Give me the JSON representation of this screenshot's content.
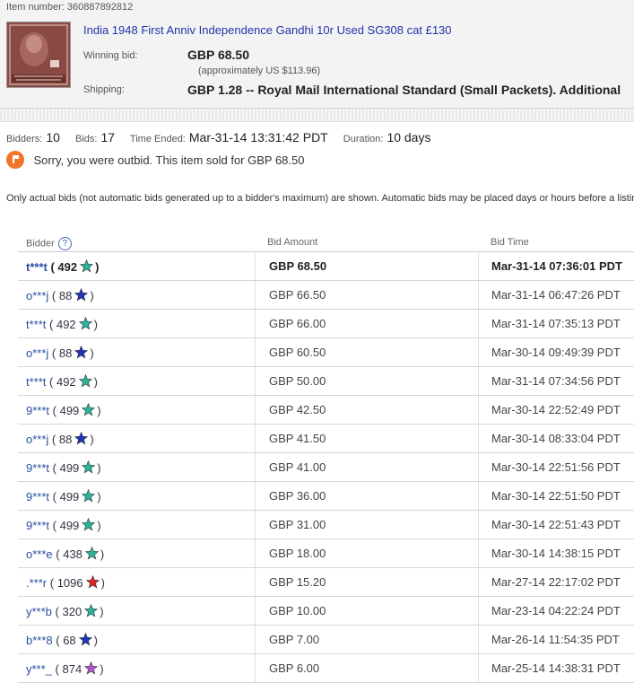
{
  "item": {
    "number_text": "Item number: 360887892812",
    "title": "India 1948 First Anniv Independence Gandhi 10r Used SG308 cat £130",
    "winning_bid_label": "Winning bid:",
    "winning_bid": "GBP 68.50",
    "winning_bid_approx": "(approximately US $113.96)",
    "shipping_label": "Shipping:",
    "shipping": "GBP 1.28 -- Royal Mail International Standard (Small Packets).  Additional"
  },
  "stats": {
    "bidders_label": "Bidders:",
    "bidders": "10",
    "bids_label": "Bids:",
    "bids": "17",
    "time_ended_label": "Time Ended:",
    "time_ended": "Mar-31-14 13:31:42 PDT",
    "duration_label": "Duration:",
    "duration": "10 days"
  },
  "outbid_message": "Sorry, you were outbid. This item sold for GBP 68.50",
  "note": "Only actual bids (not automatic bids generated up to a bidder's maximum) are shown. Automatic bids may be placed days or hours before a listing",
  "table": {
    "headers": {
      "bidder": "Bidder",
      "help": "?",
      "amount": "Bid Amount",
      "time": "Bid Time"
    },
    "rows": [
      {
        "name": "t***t",
        "score": "492",
        "star": "teal",
        "amount": "GBP 68.50",
        "time": "Mar-31-14 07:36:01 PDT"
      },
      {
        "name": "o***j",
        "score": "88",
        "star": "blue",
        "amount": "GBP 66.50",
        "time": "Mar-31-14 06:47:26 PDT"
      },
      {
        "name": "t***t",
        "score": "492",
        "star": "teal",
        "amount": "GBP 66.00",
        "time": "Mar-31-14 07:35:13 PDT"
      },
      {
        "name": "o***j",
        "score": "88",
        "star": "blue",
        "amount": "GBP 60.50",
        "time": "Mar-30-14 09:49:39 PDT"
      },
      {
        "name": "t***t",
        "score": "492",
        "star": "teal",
        "amount": "GBP 50.00",
        "time": "Mar-31-14 07:34:56 PDT"
      },
      {
        "name": "9***t",
        "score": "499",
        "star": "teal",
        "amount": "GBP 42.50",
        "time": "Mar-30-14 22:52:49 PDT"
      },
      {
        "name": "o***j",
        "score": "88",
        "star": "blue",
        "amount": "GBP 41.50",
        "time": "Mar-30-14 08:33:04 PDT"
      },
      {
        "name": "9***t",
        "score": "499",
        "star": "teal",
        "amount": "GBP 41.00",
        "time": "Mar-30-14 22:51:56 PDT"
      },
      {
        "name": "9***t",
        "score": "499",
        "star": "teal",
        "amount": "GBP 36.00",
        "time": "Mar-30-14 22:51:50 PDT"
      },
      {
        "name": "9***t",
        "score": "499",
        "star": "teal",
        "amount": "GBP 31.00",
        "time": "Mar-30-14 22:51:43 PDT"
      },
      {
        "name": "o***e",
        "score": "438",
        "star": "teal",
        "amount": "GBP 18.00",
        "time": "Mar-30-14 14:38:15 PDT"
      },
      {
        "name": ".***r",
        "score": "1096",
        "star": "red",
        "amount": "GBP 15.20",
        "time": "Mar-27-14 22:17:02 PDT"
      },
      {
        "name": "y***b",
        "score": "320",
        "star": "teal",
        "amount": "GBP 10.00",
        "time": "Mar-23-14 04:22:24 PDT"
      },
      {
        "name": "b***8",
        "score": "68",
        "star": "blue",
        "amount": "GBP 7.00",
        "time": "Mar-26-14 11:54:35 PDT"
      },
      {
        "name": "y***_",
        "score": "874",
        "star": "purple",
        "amount": "GBP 6.00",
        "time": "Mar-25-14 14:38:31 PDT"
      }
    ]
  },
  "colors": {
    "teal": "#2bb39b",
    "blue": "#2233bb",
    "red": "#dd2222",
    "purple": "#b055cc",
    "accent": "#f0742a"
  }
}
